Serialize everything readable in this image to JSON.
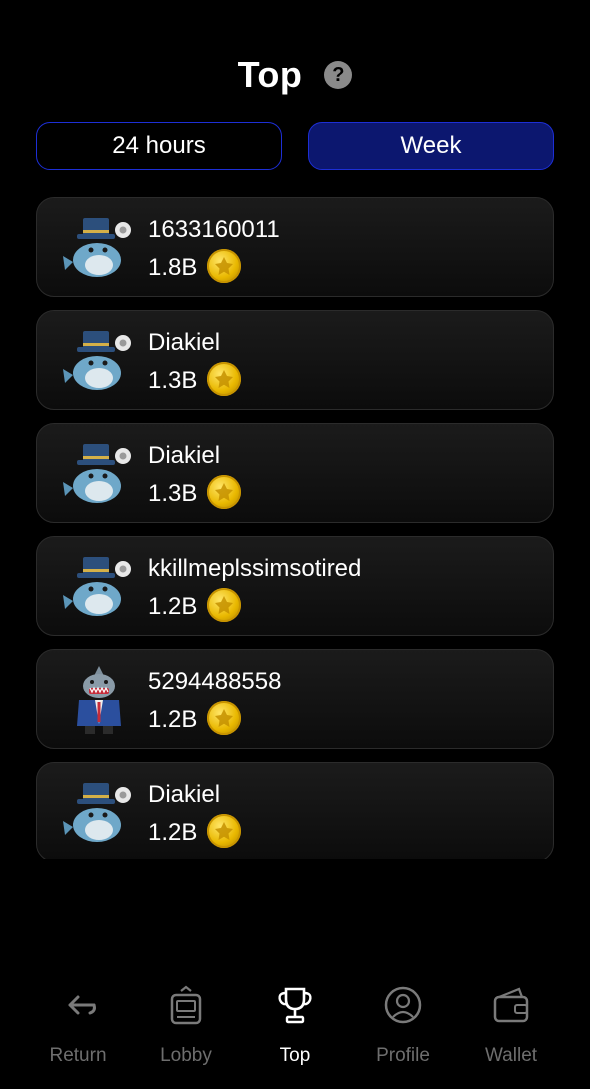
{
  "header": {
    "title": "Top",
    "help_icon": "question-circle-icon",
    "help_text": "?"
  },
  "tabs": [
    {
      "label": "24 hours",
      "active": false
    },
    {
      "label": "Week",
      "active": true
    }
  ],
  "leaderboard": [
    {
      "name": "1633160011",
      "score": "1.8B",
      "avatar": "whale-avatar-icon"
    },
    {
      "name": "Diakiel",
      "score": "1.3B",
      "avatar": "whale-avatar-icon"
    },
    {
      "name": "Diakiel",
      "score": "1.3B",
      "avatar": "whale-avatar-icon"
    },
    {
      "name": "kkillmeplssimsotired",
      "score": "1.2B",
      "avatar": "whale-avatar-icon"
    },
    {
      "name": "5294488558",
      "score": "1.2B",
      "avatar": "shark-avatar-icon"
    },
    {
      "name": "Diakiel",
      "score": "1.2B",
      "avatar": "whale-avatar-icon"
    }
  ],
  "coin_icon": "gold-coin-icon",
  "nav": [
    {
      "label": "Return",
      "icon": "return-arrow-icon",
      "active": false
    },
    {
      "label": "Lobby",
      "icon": "slot-machine-icon",
      "active": false
    },
    {
      "label": "Top",
      "icon": "trophy-icon",
      "active": true
    },
    {
      "label": "Profile",
      "icon": "profile-icon",
      "active": false
    },
    {
      "label": "Wallet",
      "icon": "wallet-icon",
      "active": false
    }
  ],
  "colors": {
    "background": "#000000",
    "tab_border": "#1d2fd6",
    "tab_active_bg": "#0c176f",
    "coin_gold": "#e9b800",
    "nav_inactive": "#6e6e6e"
  }
}
